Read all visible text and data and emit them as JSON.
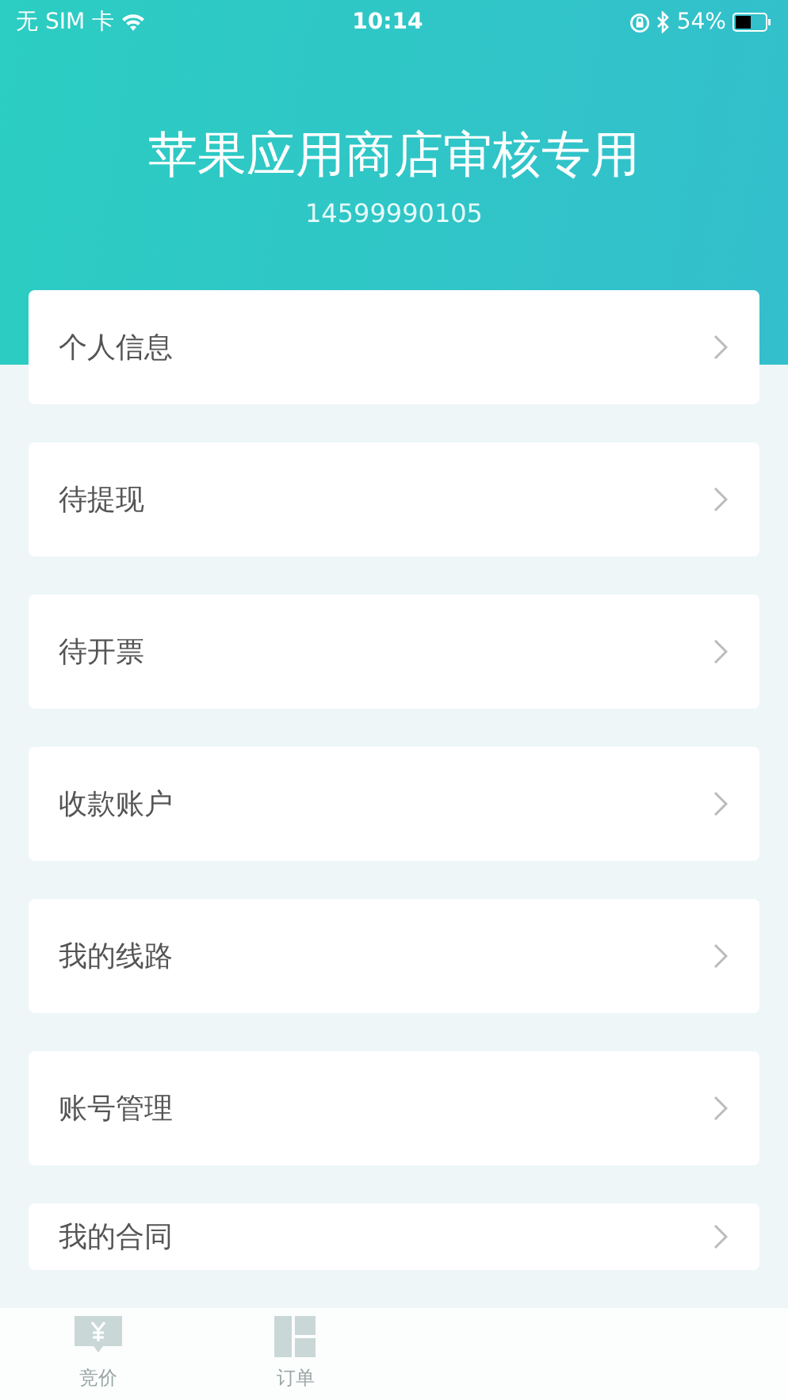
{
  "status_bar": {
    "carrier": "无 SIM 卡",
    "time": "10:14",
    "battery": "54%"
  },
  "profile": {
    "name": "苹果应用商店审核专用",
    "phone": "14599990105"
  },
  "menu": [
    {
      "label": "个人信息"
    },
    {
      "label": "待提现"
    },
    {
      "label": "待开票"
    },
    {
      "label": "收款账户"
    },
    {
      "label": "我的线路"
    },
    {
      "label": "账号管理"
    },
    {
      "label": "我的合同"
    }
  ],
  "tab_bar": [
    {
      "label": "竞价",
      "kind": "bid",
      "selected": false
    },
    {
      "label": "订单",
      "kind": "orders",
      "selected": false
    }
  ]
}
